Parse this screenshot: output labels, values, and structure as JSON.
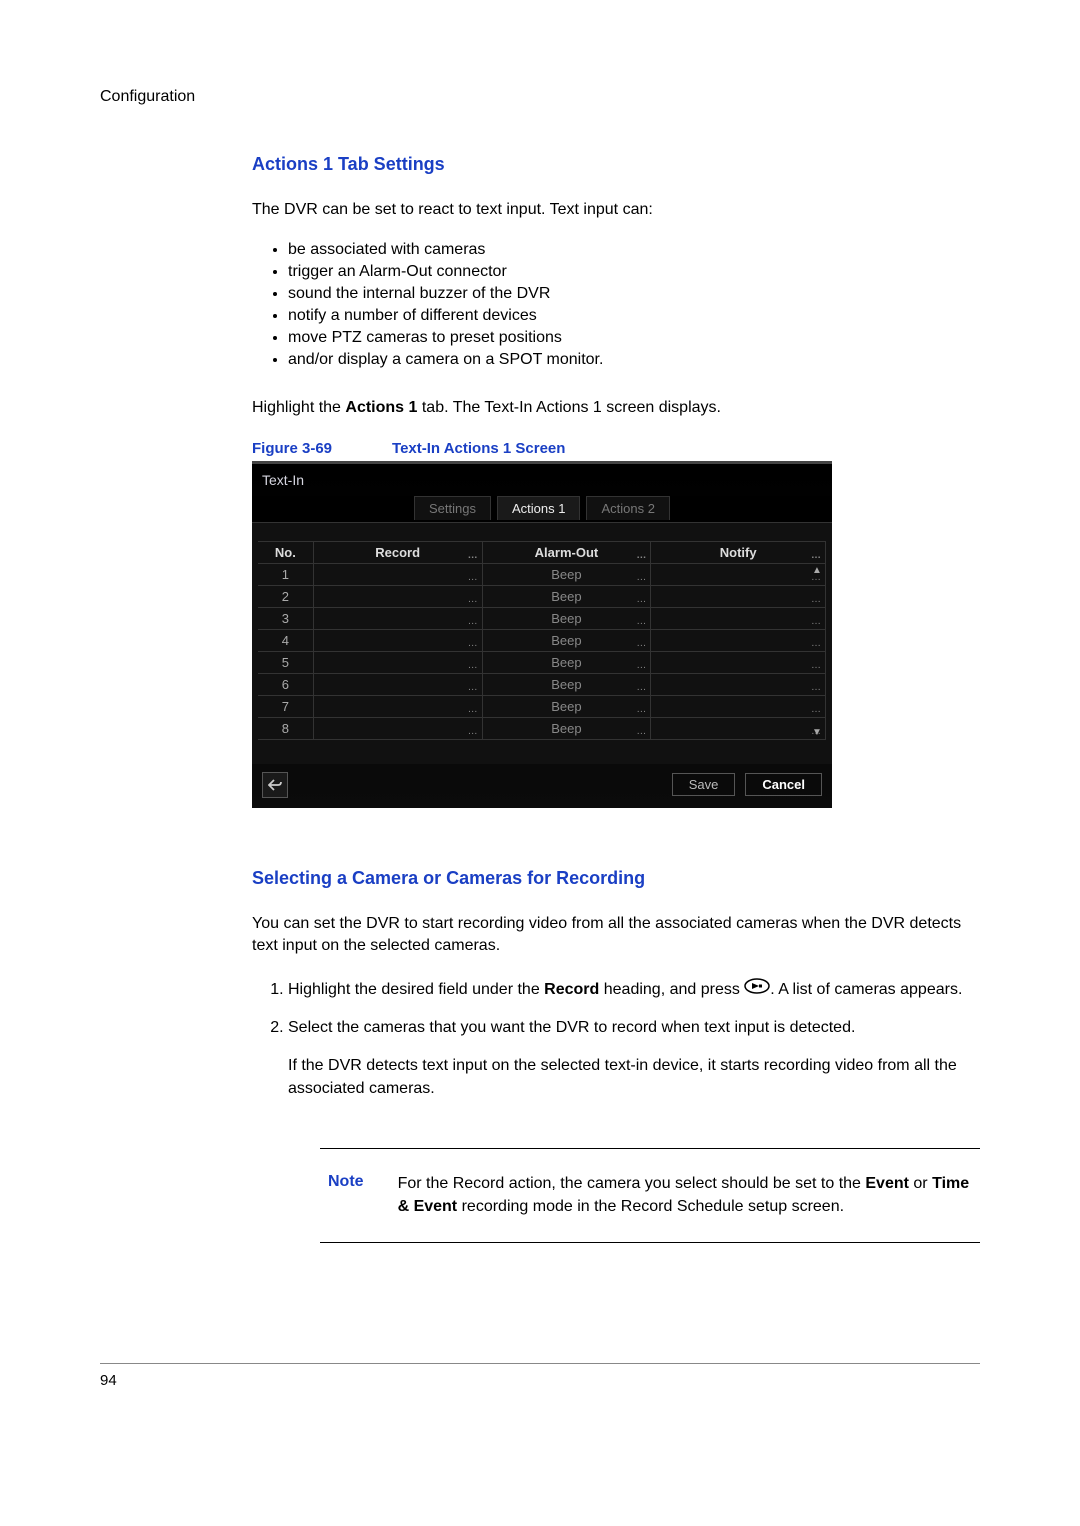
{
  "header": {
    "section": "Configuration"
  },
  "section1": {
    "title": "Actions 1 Tab Settings",
    "intro": "The DVR can be set to react to text input. Text input can:",
    "bullets": [
      "be associated with cameras",
      "trigger an Alarm-Out connector",
      "sound the internal buzzer of the DVR",
      "notify a number of different devices",
      "move PTZ cameras to preset positions",
      "and/or display a camera on a SPOT monitor."
    ],
    "highlight_pre": "Highlight the ",
    "highlight_bold": "Actions 1",
    "highlight_post": " tab. The Text-In Actions 1 screen displays."
  },
  "figure": {
    "label": "Figure 3-69",
    "title": "Text-In Actions 1 Screen"
  },
  "dvr": {
    "window_title": "Text-In",
    "tabs": {
      "settings": "Settings",
      "actions1": "Actions 1",
      "actions2": "Actions 2"
    },
    "columns": {
      "no": "No.",
      "record": "Record",
      "alarm": "Alarm-Out",
      "notify": "Notify"
    },
    "rows": [
      {
        "no": "1",
        "record": "",
        "alarm": "Beep",
        "notify": ""
      },
      {
        "no": "2",
        "record": "",
        "alarm": "Beep",
        "notify": ""
      },
      {
        "no": "3",
        "record": "",
        "alarm": "Beep",
        "notify": ""
      },
      {
        "no": "4",
        "record": "",
        "alarm": "Beep",
        "notify": ""
      },
      {
        "no": "5",
        "record": "",
        "alarm": "Beep",
        "notify": ""
      },
      {
        "no": "6",
        "record": "",
        "alarm": "Beep",
        "notify": ""
      },
      {
        "no": "7",
        "record": "",
        "alarm": "Beep",
        "notify": ""
      },
      {
        "no": "8",
        "record": "",
        "alarm": "Beep",
        "notify": ""
      }
    ],
    "buttons": {
      "save": "Save",
      "cancel": "Cancel"
    }
  },
  "section2": {
    "title": "Selecting a Camera or Cameras for Recording",
    "intro": "You can set the DVR to start recording video from all the associated cameras when the DVR detects text input on the selected cameras.",
    "step1_pre": "Highlight the desired field under the ",
    "step1_bold": "Record",
    "step1_mid": " heading, and press ",
    "step1_post": ". A list of cameras appears.",
    "step2": "Select the cameras that you want the DVR to record when text input is detected.",
    "step2_after": "If the DVR detects text input on the selected text-in device, it starts recording video from all the associated cameras."
  },
  "note": {
    "label": "Note",
    "text_pre": "For the Record action, the camera you select should be set to the ",
    "text_bold1": "Event",
    "text_mid": " or ",
    "text_bold2": "Time & Event",
    "text_post": " recording mode in the Record Schedule setup screen."
  },
  "footer": {
    "page_number": "94"
  }
}
